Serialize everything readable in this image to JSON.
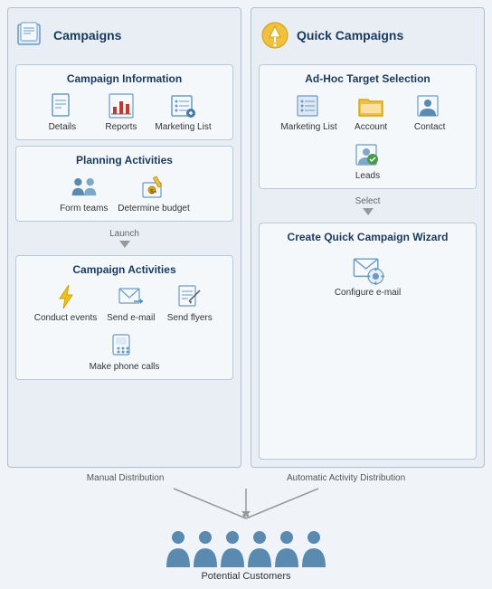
{
  "left_panel": {
    "title": "Campaigns",
    "campaign_info": {
      "title": "Campaign Information",
      "items": [
        {
          "label": "Details",
          "icon": "document-icon"
        },
        {
          "label": "Reports",
          "icon": "chart-icon"
        },
        {
          "label": "Marketing List",
          "icon": "list-icon"
        }
      ]
    },
    "planning": {
      "title": "Planning Activities",
      "items": [
        {
          "label": "Form teams",
          "icon": "team-icon"
        },
        {
          "label": "Determine budget",
          "icon": "budget-icon"
        }
      ]
    },
    "arrow_label": "Launch",
    "campaign_activities": {
      "title": "Campaign Activities",
      "items": [
        {
          "label": "Conduct events",
          "icon": "lightning-icon"
        },
        {
          "label": "Send e-mail",
          "icon": "email-icon"
        },
        {
          "label": "Send flyers",
          "icon": "flyer-icon"
        },
        {
          "label": "Make phone calls",
          "icon": "phone-icon"
        }
      ]
    }
  },
  "right_panel": {
    "title": "Quick Campaigns",
    "adhoc": {
      "title": "Ad-Hoc Target Selection",
      "items": [
        {
          "label": "Marketing List",
          "icon": "marketing-list-icon"
        },
        {
          "label": "Account",
          "icon": "account-icon"
        },
        {
          "label": "Contact",
          "icon": "contact-icon"
        },
        {
          "label": "Leads",
          "icon": "leads-icon"
        }
      ]
    },
    "arrow_label": "Select",
    "wizard": {
      "title": "Create Quick Campaign Wizard",
      "items": [
        {
          "label": "Configure e-mail",
          "icon": "configure-email-icon"
        }
      ]
    }
  },
  "bottom": {
    "left_label": "Manual Distribution",
    "right_label": "Automatic Activity Distribution",
    "customers_label": "Potential Customers"
  }
}
